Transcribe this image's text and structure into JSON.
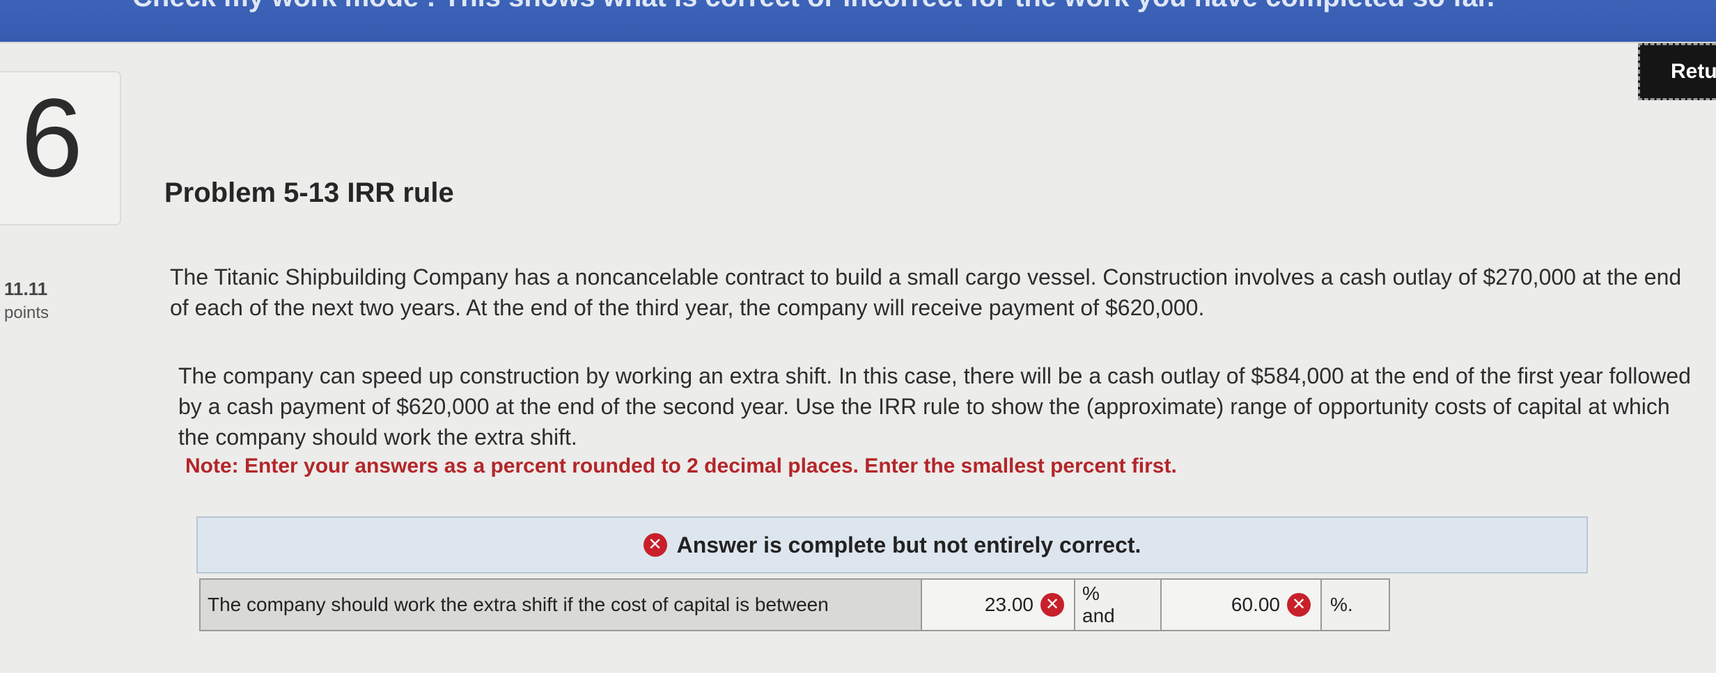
{
  "header": {
    "banner_text": "Check my work mode : This shows what is correct or incorrect for the work you have completed so far."
  },
  "question": {
    "number": "6",
    "points_value": "11.11",
    "points_label": "points"
  },
  "return_button": {
    "label": "Retu"
  },
  "problem": {
    "title": "Problem 5-13 IRR rule",
    "paragraph1": "The Titanic Shipbuilding Company has a noncancelable contract to build a small cargo vessel. Construction involves a cash outlay of $270,000 at the end of each of the next two years. At the end of the third year, the company will receive payment of $620,000.",
    "paragraph2": "The company can speed up construction by working an extra shift. In this case, there will be a cash outlay of $584,000 at the end of the first year followed by a cash payment of $620,000 at the end of the second year. Use the IRR rule to show the (approximate) range of opportunity costs of capital at which the company should work the extra shift.",
    "note": "Note: Enter your answers as a percent rounded to 2 decimal places. Enter the smallest percent first."
  },
  "answer": {
    "status": "Answer is complete but not entirely correct.",
    "status_icon": "incorrect-x-icon",
    "row_label": "The company should work the extra shift if the cost of capital is between",
    "value1": "23.00",
    "unit1": "%",
    "connector": "and",
    "value2": "60.00",
    "unit2": "%."
  },
  "colors": {
    "banner": "#3458ad",
    "note_red": "#b3262a",
    "error_red": "#c8202a",
    "answer_header_bg": "#dde6ef"
  }
}
